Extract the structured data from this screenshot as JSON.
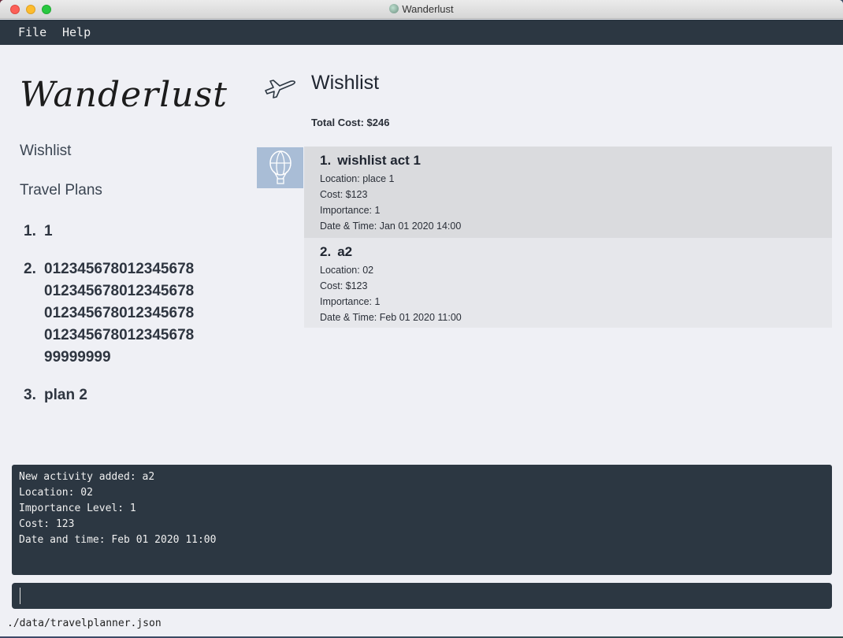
{
  "window": {
    "title": "Wanderlust",
    "icon": "app-globe-icon"
  },
  "menubar": {
    "items": [
      {
        "label": "File"
      },
      {
        "label": "Help"
      }
    ]
  },
  "sidebar": {
    "logo": "Wanderlust",
    "nav": [
      {
        "label": "Wishlist"
      },
      {
        "label": "Travel Plans"
      }
    ],
    "plans": [
      {
        "num": "1.",
        "name": "1"
      },
      {
        "num": "2.",
        "name": "01234567801234567801234567801234567801234567801234567801234567801234567899999999"
      },
      {
        "num": "3.",
        "name": "plan 2"
      }
    ]
  },
  "main": {
    "title": "Wishlist",
    "icon": "airplane-icon",
    "total_cost": "Total Cost: $246",
    "activities": [
      {
        "num": "1.",
        "name": "wishlist act 1",
        "location": "Location: place 1",
        "cost": "Cost: $123",
        "importance": "Importance: 1",
        "datetime": "Date & Time: Jan 01 2020 14:00",
        "icon": "hot-air-balloon-icon",
        "selected": true
      },
      {
        "num": "2.",
        "name": "a2",
        "location": "Location: 02",
        "cost": "Cost: $123",
        "importance": "Importance: 1",
        "datetime": "Date & Time: Feb 01 2020 11:00"
      }
    ]
  },
  "result": {
    "lines": [
      "New activity added: a2",
      "Location: 02",
      "Importance Level: 1",
      "Cost: 123",
      "Date and time: Feb 01 2020 11:00"
    ]
  },
  "command": {
    "value": ""
  },
  "status": {
    "path": "./data/travelplanner.json"
  },
  "colors": {
    "menubar_bg": "#2c3742",
    "panel_bg": "#eff0f5",
    "selected_card": "#dadbde",
    "balloon_bg": "#a9bdd6"
  }
}
